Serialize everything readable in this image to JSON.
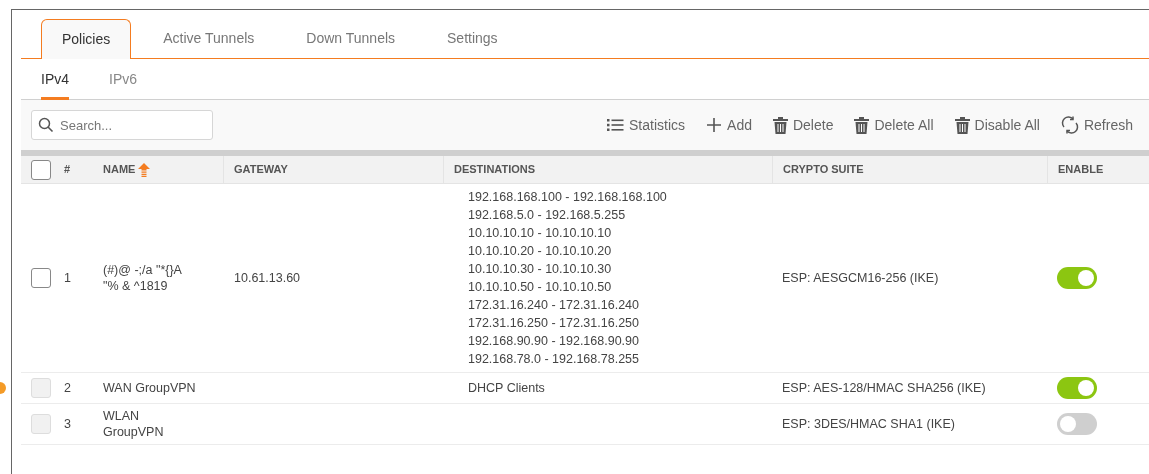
{
  "tabs": [
    {
      "label": "Policies",
      "selected": true
    },
    {
      "label": "Active Tunnels",
      "selected": false
    },
    {
      "label": "Down Tunnels",
      "selected": false
    },
    {
      "label": "Settings",
      "selected": false
    }
  ],
  "subtabs": [
    {
      "label": "IPv4",
      "selected": true
    },
    {
      "label": "IPv6",
      "selected": false
    }
  ],
  "search": {
    "placeholder": "Search..."
  },
  "toolbar": [
    {
      "kind": "list",
      "label": "Statistics"
    },
    {
      "kind": "add",
      "label": "Add"
    },
    {
      "kind": "trash",
      "label": "Delete"
    },
    {
      "kind": "trash",
      "label": "Delete All"
    },
    {
      "kind": "trash",
      "label": "Disable All"
    },
    {
      "kind": "refresh",
      "label": "Refresh"
    }
  ],
  "table": {
    "select_all_checked": false,
    "columns": [
      "#",
      "NAME",
      "GATEWAY",
      "DESTINATIONS",
      "CRYPTO SUITE",
      "ENABLE"
    ],
    "rows": [
      {
        "number": "1",
        "name": "(#)@ -;/a \"*{}A \"% & ^1819",
        "gateway": "10.61.13.60",
        "destinations": [
          "192.168.168.100 - 192.168.168.100",
          "192.168.5.0 - 192.168.5.255",
          "10.10.10.10 - 10.10.10.10",
          "10.10.10.20 - 10.10.10.20",
          "10.10.10.30 - 10.10.10.30",
          "10.10.10.50 - 10.10.10.50",
          "172.31.16.240 - 172.31.16.240",
          "172.31.16.250 - 172.31.16.250",
          "192.168.90.90 - 192.168.90.90",
          "192.168.78.0 - 192.168.78.255"
        ],
        "crypto": "ESP: AESGCM16-256 (IKE)",
        "enabled": true,
        "checkbox_disabled": false,
        "marker": false
      },
      {
        "number": "2",
        "name": "WAN GroupVPN",
        "destinations": [
          "DHCP Clients"
        ],
        "crypto": "ESP: AES-128/HMAC SHA256 (IKE)",
        "enabled": true,
        "checkbox_disabled": true,
        "marker": true
      },
      {
        "number": "3",
        "name": "WLAN GroupVPN",
        "destinations": [],
        "crypto": "ESP: 3DES/HMAC SHA1 (IKE)",
        "enabled": false,
        "checkbox_disabled": true,
        "marker": false
      }
    ]
  }
}
